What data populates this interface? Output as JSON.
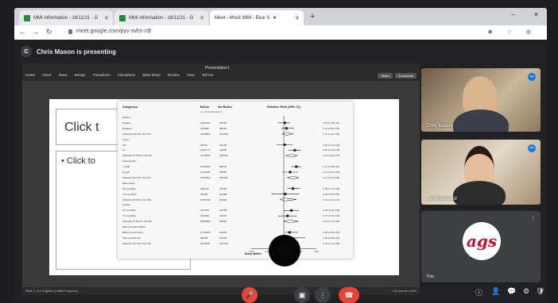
{
  "browser": {
    "tabs": [
      {
        "label": "MMI information - 16/11/21 - G"
      },
      {
        "label": "MMI information - 16/11/21 - G"
      },
      {
        "label": "Meet - Mock MMI - Blue S"
      }
    ],
    "url": "meet.google.com/pyv-xvhn-rdt"
  },
  "meet": {
    "presenter_initial": "C",
    "presenting_text": "Chris Mason is presenting",
    "participants": [
      {
        "name": "Chris Mason"
      },
      {
        "name": "...a Woodward"
      },
      {
        "name": "You"
      }
    ],
    "you_logo": "ags"
  },
  "ppt": {
    "title": "Presentation1",
    "menu": [
      "Home",
      "Insert",
      "Draw",
      "Design",
      "Transitions",
      "Animations",
      "Slide Show",
      "Review",
      "View",
      "Tell me"
    ],
    "share_label": "Share",
    "comments_label": "Comments",
    "status_left": "Slide 1 of 1   English (United Kingdom)",
    "status_right": "Comments   100%",
    "slide": {
      "title_placeholder": "Click t",
      "body_placeholder": "• Click to"
    }
  },
  "forest": {
    "col_subgroup": "Subgroup",
    "col_bolus": "Bolus",
    "col_nobolus": "No Bolus",
    "col_units": "no. of events/total no.",
    "col_rr": "Relative Risk (95% CI)",
    "rows": [
      {
        "label": "Melanin",
        "bolus": "",
        "nobolus": "",
        "ci": ""
      },
      {
        "label": "  Positive",
        "bolus": "136/1292",
        "nobolus": "94/983",
        "ci": "1.05 (1.78-1.31)"
      },
      {
        "label": "  Negative",
        "bolus": "158/984",
        "nobolus": "38/446",
        "ci": "1.12 (0.90-1.55)"
      },
      {
        "label": "  Subtotal (I²=0.0%, P=0.40)",
        "bolus": "216/2896",
        "nobolus": "76/3049",
        "ci": "1.11 (1.13-1.49)"
      },
      {
        "label": "Colour",
        "bolus": "",
        "nobolus": "",
        "ci": ""
      },
      {
        "label": "  Yes",
        "bolus": "78/337",
        "nobolus": "33/148",
        "ci": "1.04 (0.73-1.48)"
      },
      {
        "label": "  No",
        "bolus": "143/1777",
        "nobolus": "43/969",
        "ci": "1.60 (1.23-2.05)"
      },
      {
        "label": "  Subtotal (I²=76.5%, P=0.04)",
        "bolus": "221/2084",
        "nobolus": "76/2044",
        "ci": "1.40 (1.09-1.79)"
      },
      {
        "label": "Haemoglobin",
        "bolus": "",
        "nobolus": "",
        "ci": ""
      },
      {
        "label": "  <3 g/dl",
        "bolus": "101/1993",
        "nobolus": "38/143",
        "ci": "1.71 (1.39-2.50)"
      },
      {
        "label": "  ≥3 g/dl",
        "bolus": "114/1584",
        "nobolus": "45/983",
        "ci": "1.31 (0.93-1.84)"
      },
      {
        "label": "  Subtotal (I²=2.9%, P=0.31)",
        "bolus": "215/2814",
        "nobolus": "75/1543",
        "ci": "1.47 (1.16-1.88)"
      },
      {
        "label": "Base deficit",
        "bolus": "",
        "nobolus": "",
        "ci": ""
      },
      {
        "label": "  ≤8 mmol/liter",
        "bolus": "138/749",
        "nobolus": "44/348",
        "ci": "1.48 (1.16-1.99)"
      },
      {
        "label": "  >8 mmol/liter",
        "bolus": "30/359",
        "nobolus": "20/358",
        "ci": "1.06 (0.59-1.93)"
      },
      {
        "label": "  Subtotal (I²=4.8%, P=0.28)",
        "bolus": "148/1568",
        "nobolus": "64/696",
        "ci": "1.04 (1.13-1.71)"
      },
      {
        "label": "Lactate",
        "bolus": "",
        "nobolus": "",
        "ci": ""
      },
      {
        "label": "  ≤5 mmol/liter",
        "bolus": "127/784",
        "nobolus": "28/395",
        "ci": "1.38 (1.00-1.90)"
      },
      {
        "label": "  >5 mmol/liter",
        "bolus": "49/1253",
        "nobolus": "31/297",
        "ci": "1.17 (0.79-1.72)"
      },
      {
        "label": "  Subtotal (I²=15.2%, P=0.28)",
        "bolus": "205/1989",
        "nobolus": "59/992",
        "ci": "1.30 (1.17-1.85)"
      },
      {
        "label": "Date of randomization",
        "bolus": "",
        "nobolus": "",
        "ci": ""
      },
      {
        "label": "  Before amendment",
        "bolus": "171/1893",
        "nobolus": "61/994",
        "ci": "1.28 (1.05-1.83)"
      },
      {
        "label": "  After amendment",
        "bolus": "38/498",
        "nobolus": "14/200",
        "ci": "1.35 (0.69-2.50)"
      },
      {
        "label": "  Subtotal (I²=0.0%, P=0.78)",
        "bolus": "211/1891",
        "nobolus": "76/1044",
        "ci": "1.40 (1.13-1.89)"
      }
    ],
    "points": [
      null,
      1.05,
      1.12,
      1.11,
      null,
      1.04,
      1.6,
      1.4,
      null,
      1.71,
      1.31,
      1.47,
      null,
      1.48,
      1.06,
      1.04,
      null,
      1.38,
      1.17,
      1.3,
      null,
      1.28,
      1.35,
      1.4
    ],
    "lower": [
      null,
      0.78,
      0.9,
      0.93,
      null,
      0.73,
      1.23,
      1.09,
      null,
      1.39,
      0.93,
      1.16,
      null,
      1.16,
      0.59,
      0.86,
      null,
      1.0,
      0.79,
      1.0,
      null,
      1.05,
      0.69,
      1.13
    ],
    "upper": [
      null,
      1.31,
      1.55,
      1.49,
      null,
      1.48,
      2.05,
      1.79,
      null,
      2.1,
      1.84,
      1.88,
      null,
      1.99,
      1.93,
      1.71,
      null,
      1.9,
      1.72,
      1.85,
      null,
      1.83,
      2.5,
      1.89
    ],
    "ticks": [
      "0.25",
      "0.50",
      "1.00",
      "2.00",
      "4.00"
    ],
    "label_left": "Bolus Better",
    "label_right": "No Bolus Better"
  }
}
